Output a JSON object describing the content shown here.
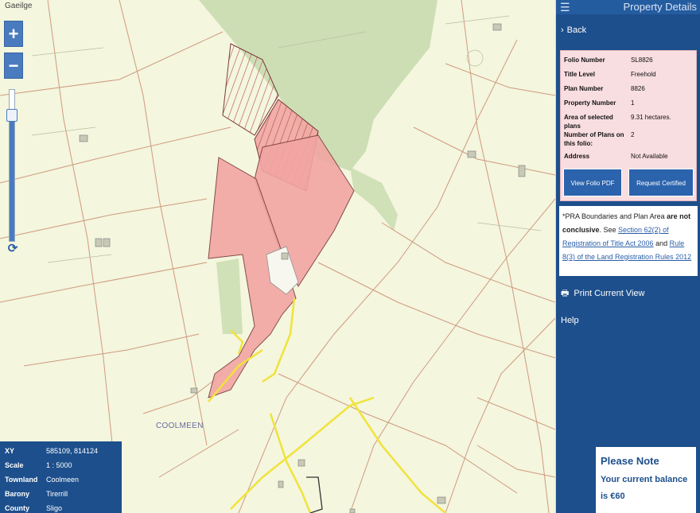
{
  "map": {
    "language_link": "Gaeilge",
    "zoom_in": "+",
    "zoom_out": "−",
    "refresh_glyph": "⟳",
    "townland_label": "COOLMEEN"
  },
  "info_box": {
    "rows": [
      {
        "key": "XY",
        "value": "585109, 814124"
      },
      {
        "key": "Scale",
        "value": "1 : 5000"
      },
      {
        "key": "Townland",
        "value": "Coolmeen"
      },
      {
        "key": "Barony",
        "value": "Tirerrill"
      },
      {
        "key": "County",
        "value": "Sligo"
      }
    ]
  },
  "panel": {
    "menu_glyph": "☰",
    "title": "Property Details",
    "back_label": "Back",
    "back_glyph": "›",
    "details": [
      {
        "key": "Folio Number",
        "value": "SL8826"
      },
      {
        "key": "Title Level",
        "value": "Freehold"
      },
      {
        "key": "Plan Number",
        "value": "8826"
      },
      {
        "key": "Property Number",
        "value": "1"
      },
      {
        "key": "Area of selected plans",
        "value": "9.31 hectares."
      },
      {
        "key": "Number of Plans on this folio:",
        "value": "2"
      },
      {
        "key": "Address",
        "value": "Not Available"
      }
    ],
    "view_folio_button": "View Folio PDF",
    "certified_copy_button": "Request Certified Copy",
    "disclaimer": {
      "prefix": "*PRA Boundaries and Plan Area ",
      "bold": "are not conclusive",
      "see": ". See ",
      "link1": "Section 62(2) of Registration of Title Act 2006",
      "and": " and ",
      "link2": "Rule 8(3) of the Land Registration Rules 2012"
    },
    "print_label": "Print Current View",
    "print_glyph": "🖶",
    "help_label": "Help"
  },
  "balance": {
    "heading": "Please Note",
    "text": "Your current balance is €60"
  },
  "colors": {
    "panel_blue": "#1d4f8c",
    "button_blue": "#2b63ac",
    "parcel_pink": "#f2a6a3",
    "forest_green": "#c9dcb0",
    "road_yellow": "#f0e33a",
    "boundary_brown": "#c98b6e"
  }
}
